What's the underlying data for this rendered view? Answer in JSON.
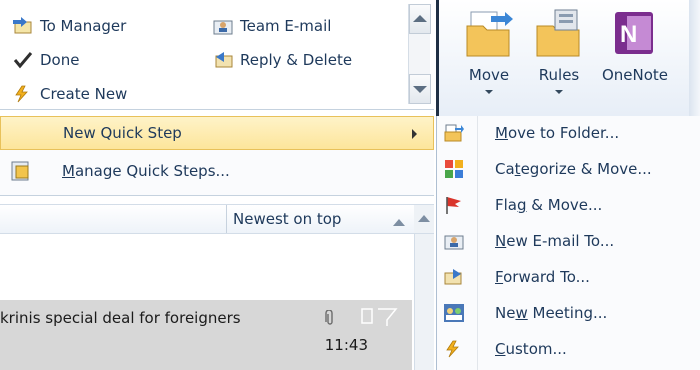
{
  "gallery": {
    "items": [
      {
        "label": "To Manager",
        "icon": "arrow-right-envelope-icon"
      },
      {
        "label": "Team E-mail",
        "icon": "team-email-icon"
      },
      {
        "label": "Done",
        "icon": "checkmark-icon"
      },
      {
        "label": "Reply & Delete",
        "icon": "reply-delete-icon"
      },
      {
        "label": "Create New",
        "icon": "lightning-icon"
      }
    ]
  },
  "ribbon": {
    "move": "Move",
    "rules": "Rules",
    "onenote": "OneNote"
  },
  "left_menu": {
    "new_quick_step": "New Quick Step",
    "manage_quick_steps_underline": "M",
    "manage_quick_steps_rest": "anage Quick Steps..."
  },
  "list": {
    "sort_label": "Newest on top",
    "message_subject": "krinis special deal for foreigners",
    "message_time": "11:43"
  },
  "submenu": {
    "items": [
      {
        "u": "M",
        "rest": "ove to Folder...",
        "icon": "move-to-folder-icon"
      },
      {
        "pre": "Ca",
        "u": "t",
        "rest": "egorize & Move...",
        "icon": "categorize-icon"
      },
      {
        "pre": "Fla",
        "u": "g",
        "rest": " & Move...",
        "icon": "flag-icon"
      },
      {
        "u": "N",
        "rest": "ew E-mail To...",
        "icon": "new-email-icon"
      },
      {
        "u": "F",
        "rest": "orward To...",
        "icon": "forward-icon"
      },
      {
        "pre": "Ne",
        "u": "w",
        "rest": " Meeting...",
        "icon": "meeting-icon"
      },
      {
        "u": "C",
        "rest": "ustom...",
        "icon": "custom-icon"
      }
    ]
  },
  "colors": {
    "highlight": "#fde59b",
    "text": "#1e395b",
    "message_bg": "#d7d7d7"
  }
}
